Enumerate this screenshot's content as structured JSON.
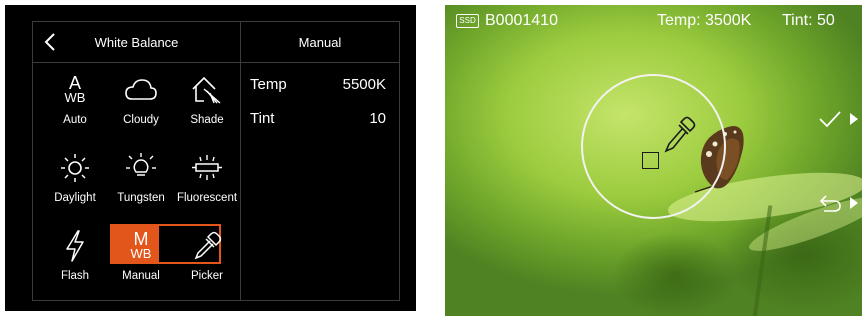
{
  "left_panel": {
    "title": "White Balance",
    "manual_header": "Manual",
    "presets": [
      {
        "label": "Auto",
        "icon": "auto-wb-icon",
        "glyph_top": "A",
        "glyph_bottom": "WB"
      },
      {
        "label": "Cloudy",
        "icon": "cloudy-icon"
      },
      {
        "label": "Shade",
        "icon": "shade-icon"
      },
      {
        "label": "Daylight",
        "icon": "daylight-icon"
      },
      {
        "label": "Tungsten",
        "icon": "tungsten-icon"
      },
      {
        "label": "Fluorescent",
        "icon": "fluorescent-icon"
      },
      {
        "label": "Flash",
        "icon": "flash-icon"
      },
      {
        "label": "Manual",
        "icon": "manual-wb-icon",
        "glyph_top": "M",
        "glyph_bottom": "WB"
      },
      {
        "label": "Picker",
        "icon": "eyedropper-icon"
      }
    ],
    "selected": "Manual",
    "params": [
      {
        "label": "Temp",
        "value": "5500K"
      },
      {
        "label": "Tint",
        "value": "10"
      }
    ],
    "accent_color": "#e2561c"
  },
  "right_panel": {
    "storage_badge": "SSD",
    "clip_name": "B0001410",
    "temp": "Temp: 3500K",
    "tint": "Tint: 50",
    "confirm_icon": "checkmark-icon",
    "undo_icon": "undo-icon"
  }
}
